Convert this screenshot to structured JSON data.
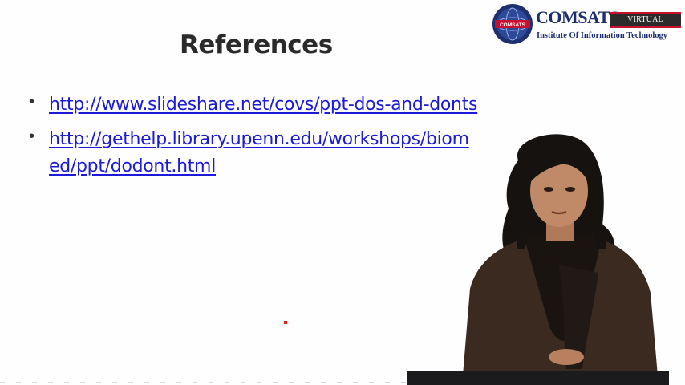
{
  "slide": {
    "title": "References",
    "references": [
      {
        "text": "http://www.slideshare.net/covs/ppt-dos-and-donts"
      },
      {
        "text": "http://gethelp.library.upenn.edu/workshops/biomed/ppt/dodont.html"
      }
    ],
    "bullet_char": "•"
  },
  "logo": {
    "brand": "COMSATS",
    "badge": "VIRTUAL CAMPUS",
    "tagline": "Institute Of Information Technology",
    "seal_text": "COMSATS"
  },
  "colors": {
    "link": "#1a1ad8",
    "title": "#2a2a2a",
    "logo_navy": "#1d2f6e",
    "logo_red": "#c8102e",
    "laser": "#e0231a"
  }
}
